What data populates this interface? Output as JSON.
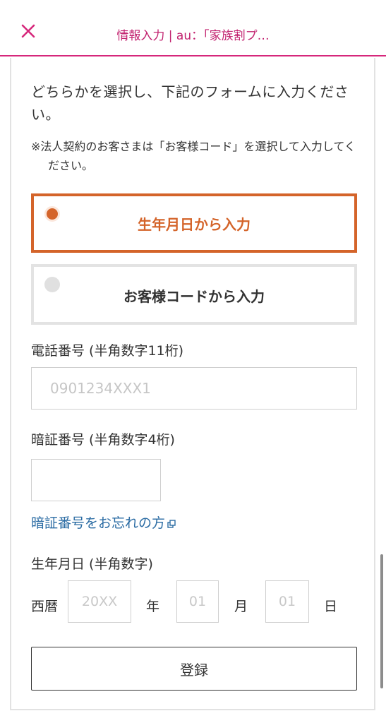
{
  "header": {
    "title": "情報入力 | au：「家族割プ…",
    "close_icon": "close-icon",
    "accent_color": "#d6277b"
  },
  "intro": {
    "text": "どちらかを選択し、下記のフォームに入力ください。",
    "note": "※法人契約のお客さまは「お客様コード」を選択して入力してください。"
  },
  "options": [
    {
      "label": "生年月日から入力",
      "selected": true,
      "color": "#d4642a"
    },
    {
      "label": "お客様コードから入力",
      "selected": false
    }
  ],
  "phone": {
    "label": "電話番号 (半角数字11桁)",
    "placeholder": "0901234XXX1"
  },
  "pin": {
    "label": "暗証番号 (半角数字4桁)",
    "value": "",
    "forgot_link": "暗証番号をお忘れの方",
    "link_color": "#2a6ba3"
  },
  "birth": {
    "label": "生年月日 (半角数字)",
    "era": "西暦",
    "year_placeholder": "20XX",
    "year_unit": "年",
    "month_placeholder": "01",
    "month_unit": "月",
    "day_placeholder": "01",
    "day_unit": "日"
  },
  "submit": {
    "label": "登録"
  }
}
